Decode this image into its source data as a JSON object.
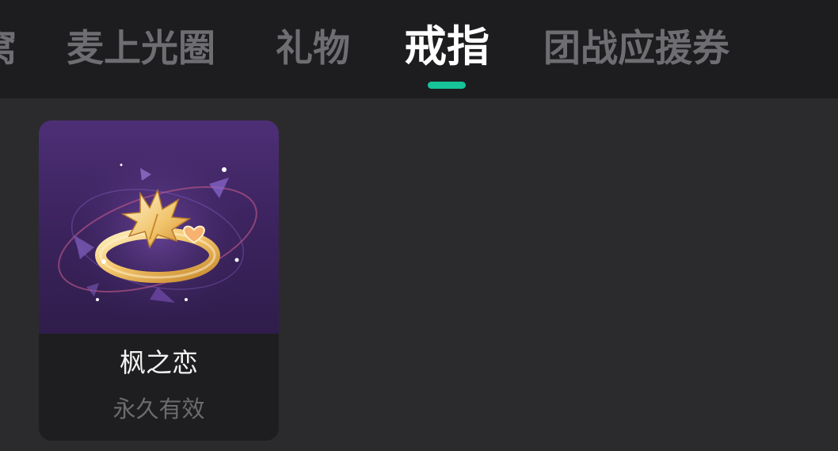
{
  "tabs": [
    {
      "label": "窝",
      "active": false
    },
    {
      "label": "麦上光圈",
      "active": false
    },
    {
      "label": "礼物",
      "active": false
    },
    {
      "label": "戒指",
      "active": true
    },
    {
      "label": "团战应援券",
      "active": false
    }
  ],
  "colors": {
    "accent": "#16c39a",
    "tabbar_bg": "#1d1d1f",
    "content_bg": "#2b2b2d",
    "card_bg": "#1e1e20"
  },
  "items": [
    {
      "name": "枫之恋",
      "status": "永久有效",
      "icon": "maple-leaf-ring-icon"
    }
  ]
}
